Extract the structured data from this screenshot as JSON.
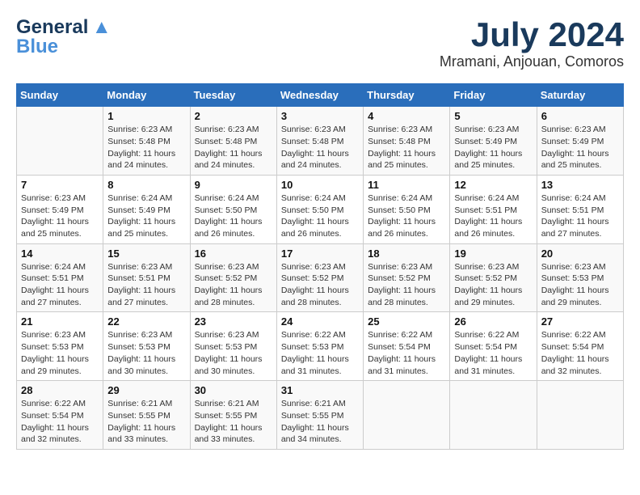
{
  "header": {
    "logo_line1": "General",
    "logo_line2": "Blue",
    "month_year": "July 2024",
    "location": "Mramani, Anjouan, Comoros"
  },
  "weekdays": [
    "Sunday",
    "Monday",
    "Tuesday",
    "Wednesday",
    "Thursday",
    "Friday",
    "Saturday"
  ],
  "weeks": [
    [
      {
        "day": "",
        "info": ""
      },
      {
        "day": "1",
        "info": "Sunrise: 6:23 AM\nSunset: 5:48 PM\nDaylight: 11 hours\nand 24 minutes."
      },
      {
        "day": "2",
        "info": "Sunrise: 6:23 AM\nSunset: 5:48 PM\nDaylight: 11 hours\nand 24 minutes."
      },
      {
        "day": "3",
        "info": "Sunrise: 6:23 AM\nSunset: 5:48 PM\nDaylight: 11 hours\nand 24 minutes."
      },
      {
        "day": "4",
        "info": "Sunrise: 6:23 AM\nSunset: 5:48 PM\nDaylight: 11 hours\nand 25 minutes."
      },
      {
        "day": "5",
        "info": "Sunrise: 6:23 AM\nSunset: 5:49 PM\nDaylight: 11 hours\nand 25 minutes."
      },
      {
        "day": "6",
        "info": "Sunrise: 6:23 AM\nSunset: 5:49 PM\nDaylight: 11 hours\nand 25 minutes."
      }
    ],
    [
      {
        "day": "7",
        "info": "Sunrise: 6:23 AM\nSunset: 5:49 PM\nDaylight: 11 hours\nand 25 minutes."
      },
      {
        "day": "8",
        "info": "Sunrise: 6:24 AM\nSunset: 5:49 PM\nDaylight: 11 hours\nand 25 minutes."
      },
      {
        "day": "9",
        "info": "Sunrise: 6:24 AM\nSunset: 5:50 PM\nDaylight: 11 hours\nand 26 minutes."
      },
      {
        "day": "10",
        "info": "Sunrise: 6:24 AM\nSunset: 5:50 PM\nDaylight: 11 hours\nand 26 minutes."
      },
      {
        "day": "11",
        "info": "Sunrise: 6:24 AM\nSunset: 5:50 PM\nDaylight: 11 hours\nand 26 minutes."
      },
      {
        "day": "12",
        "info": "Sunrise: 6:24 AM\nSunset: 5:51 PM\nDaylight: 11 hours\nand 26 minutes."
      },
      {
        "day": "13",
        "info": "Sunrise: 6:24 AM\nSunset: 5:51 PM\nDaylight: 11 hours\nand 27 minutes."
      }
    ],
    [
      {
        "day": "14",
        "info": "Sunrise: 6:24 AM\nSunset: 5:51 PM\nDaylight: 11 hours\nand 27 minutes."
      },
      {
        "day": "15",
        "info": "Sunrise: 6:23 AM\nSunset: 5:51 PM\nDaylight: 11 hours\nand 27 minutes."
      },
      {
        "day": "16",
        "info": "Sunrise: 6:23 AM\nSunset: 5:52 PM\nDaylight: 11 hours\nand 28 minutes."
      },
      {
        "day": "17",
        "info": "Sunrise: 6:23 AM\nSunset: 5:52 PM\nDaylight: 11 hours\nand 28 minutes."
      },
      {
        "day": "18",
        "info": "Sunrise: 6:23 AM\nSunset: 5:52 PM\nDaylight: 11 hours\nand 28 minutes."
      },
      {
        "day": "19",
        "info": "Sunrise: 6:23 AM\nSunset: 5:52 PM\nDaylight: 11 hours\nand 29 minutes."
      },
      {
        "day": "20",
        "info": "Sunrise: 6:23 AM\nSunset: 5:53 PM\nDaylight: 11 hours\nand 29 minutes."
      }
    ],
    [
      {
        "day": "21",
        "info": "Sunrise: 6:23 AM\nSunset: 5:53 PM\nDaylight: 11 hours\nand 29 minutes."
      },
      {
        "day": "22",
        "info": "Sunrise: 6:23 AM\nSunset: 5:53 PM\nDaylight: 11 hours\nand 30 minutes."
      },
      {
        "day": "23",
        "info": "Sunrise: 6:23 AM\nSunset: 5:53 PM\nDaylight: 11 hours\nand 30 minutes."
      },
      {
        "day": "24",
        "info": "Sunrise: 6:22 AM\nSunset: 5:53 PM\nDaylight: 11 hours\nand 31 minutes."
      },
      {
        "day": "25",
        "info": "Sunrise: 6:22 AM\nSunset: 5:54 PM\nDaylight: 11 hours\nand 31 minutes."
      },
      {
        "day": "26",
        "info": "Sunrise: 6:22 AM\nSunset: 5:54 PM\nDaylight: 11 hours\nand 31 minutes."
      },
      {
        "day": "27",
        "info": "Sunrise: 6:22 AM\nSunset: 5:54 PM\nDaylight: 11 hours\nand 32 minutes."
      }
    ],
    [
      {
        "day": "28",
        "info": "Sunrise: 6:22 AM\nSunset: 5:54 PM\nDaylight: 11 hours\nand 32 minutes."
      },
      {
        "day": "29",
        "info": "Sunrise: 6:21 AM\nSunset: 5:55 PM\nDaylight: 11 hours\nand 33 minutes."
      },
      {
        "day": "30",
        "info": "Sunrise: 6:21 AM\nSunset: 5:55 PM\nDaylight: 11 hours\nand 33 minutes."
      },
      {
        "day": "31",
        "info": "Sunrise: 6:21 AM\nSunset: 5:55 PM\nDaylight: 11 hours\nand 34 minutes."
      },
      {
        "day": "",
        "info": ""
      },
      {
        "day": "",
        "info": ""
      },
      {
        "day": "",
        "info": ""
      }
    ]
  ]
}
